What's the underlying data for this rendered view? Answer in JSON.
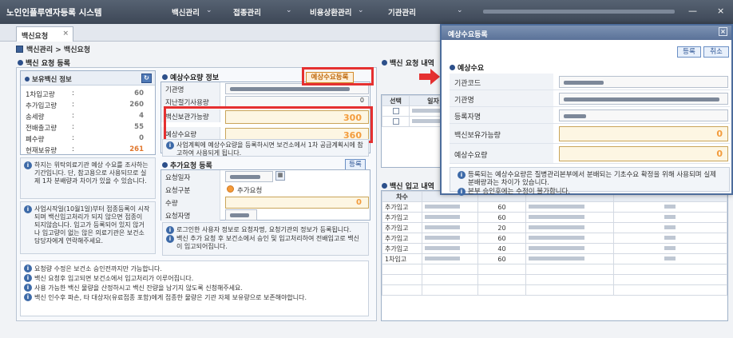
{
  "app": {
    "title": "노인인플루엔자등록 시스템"
  },
  "topmenu": {
    "vaccine_mgmt": "백신관리",
    "vaccination_mgmt": "접종관리",
    "cost_mgmt": "비용상환관리",
    "org_mgmt": "기관관리"
  },
  "window_controls": {
    "minimize": "—",
    "close": "×"
  },
  "tab": {
    "label": "백신요청",
    "close": "×"
  },
  "breadcrumb": "백신관리 > 백신요청",
  "left": {
    "section_title": "백신 요청 등록",
    "holding_title": "보유백신 정보",
    "holding_rows": [
      {
        "label": "1차입고량",
        "value": "60"
      },
      {
        "label": "추가입고량",
        "value": "260"
      },
      {
        "label": "송세량",
        "value": "4"
      },
      {
        "label": "전배출고량",
        "value": "55"
      },
      {
        "label": "폐수량",
        "value": "0"
      },
      {
        "label": "현재보유량",
        "value": "261"
      }
    ],
    "holding_note": "하지는 위탁의료기관 예상 수요를 조사하는 기간입니다. 단, 참고용으로 사용되므로 실제 1차 분배량과 차이가 있을 수 있습니다.",
    "holding_note2": "사업시작일(10월1일)부터 접종등록이 시작되며 백신입고처리가 되지 않으면 접종이 되지않습니다. 입고가 등록되어 있지 않거나 입고량이 없는 않은 의료기관은 보건소 담당자에게 연락해주세요."
  },
  "forecast": {
    "title": "예상수요량 정보",
    "register_button": "예상수요등록",
    "rows": [
      "기관명",
      "지난절기사용량",
      "백신보관가능량",
      "예상수요량"
    ],
    "last_season_value": "0",
    "storage_value": "300",
    "demand_value": "360",
    "note": "사업계획에 예상수요량을 등록하시면 보건소에서 1차 공급계획시에 참고하여 사용되게 됩니다."
  },
  "additional": {
    "title": "추가요청 등록",
    "register_button": "등록",
    "rows": [
      "요청일자",
      "요청구분",
      "수량",
      "요청자명"
    ],
    "type_value": "추가요청",
    "qty_value": "0",
    "note1": "로그인한 사용자 정보로 요청자명, 요청기관의 정보가 등록됩니다.",
    "note2": "백신 추가 요청 후 보건소에서 승인 및 입고처리하여 전배입고로 백신이 입고되어집니다."
  },
  "bottom_notes": [
    "요청량 수정은 보건소 승인전까지만 가능합니다.",
    "백신 요청후 입고되면 보건소에서 입고처리가 이루어집니다.",
    "사용 가능한 백신 물량을 산정하시고 백신 잔량을 남기지 않도록 신청해주세요.",
    "백신 인수후 파손, 타 대상자(유료접종 포함)에게 접종한 물량은 기관 자체 보유량으로 보존해야합니다."
  ],
  "right": {
    "history_title": "백신 요청 내역",
    "history_cols": [
      "선택",
      "일자"
    ],
    "inbound_title": "백신 입고 내역",
    "inbound_cols": [
      "차수"
    ],
    "inbound_rows": [
      {
        "type": "추가입고",
        "qty": "60"
      },
      {
        "type": "추가입고",
        "qty": "60"
      },
      {
        "type": "추가입고",
        "qty": "20"
      },
      {
        "type": "추가입고",
        "qty": "60"
      },
      {
        "type": "추가입고",
        "qty": "40"
      },
      {
        "type": "1차입고",
        "qty": "60"
      }
    ]
  },
  "popup": {
    "title": "예상수요등록",
    "close": "×",
    "register_button": "등록",
    "cancel_button": "취소",
    "section": "예상수요",
    "rows": [
      {
        "label": "기관코드"
      },
      {
        "label": "기관명"
      },
      {
        "label": "등록자명"
      },
      {
        "label": "백신보유가능량",
        "value": "0"
      },
      {
        "label": "예상수요량",
        "value": "0"
      }
    ],
    "note1": "등록되는 예상수요량은 질병관리본부에서 분배되는 기초수요 확정을 위해 사용되며 실제 분배량과는 차이가 있습니다.",
    "note2": "본부 승인후에는 수정이 불가합니다."
  },
  "colors": {
    "highlight": "#e53030",
    "accent_orange": "#f39c3d",
    "titlebar": "#4a5566"
  }
}
